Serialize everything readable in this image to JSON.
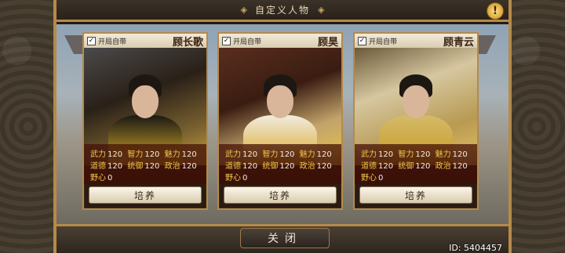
{
  "header": {
    "title": "自定义人物",
    "ornament_left": "◈",
    "ornament_right": "◈",
    "warn_icon": "!"
  },
  "cards": [
    {
      "option_label": "开局自带",
      "checked": true,
      "name": "顾长歌",
      "stats": {
        "wuli": {
          "k": "武力",
          "v": "120"
        },
        "zhili": {
          "k": "智力",
          "v": "120"
        },
        "meili": {
          "k": "魅力",
          "v": "120"
        },
        "daode": {
          "k": "道德",
          "v": "120"
        },
        "tongyu": {
          "k": "统御",
          "v": "120"
        },
        "zhengzhi": {
          "k": "政治",
          "v": "120"
        },
        "yexin": {
          "k": "野心",
          "v": "0"
        }
      },
      "train_label": "培养"
    },
    {
      "option_label": "开局自带",
      "checked": true,
      "name": "顾昊",
      "stats": {
        "wuli": {
          "k": "武力",
          "v": "120"
        },
        "zhili": {
          "k": "智力",
          "v": "120"
        },
        "meili": {
          "k": "魅力",
          "v": "120"
        },
        "daode": {
          "k": "道德",
          "v": "120"
        },
        "tongyu": {
          "k": "统御",
          "v": "120"
        },
        "zhengzhi": {
          "k": "政治",
          "v": "120"
        },
        "yexin": {
          "k": "野心",
          "v": "0"
        }
      },
      "train_label": "培养"
    },
    {
      "option_label": "开局自带",
      "checked": true,
      "name": "顾青云",
      "stats": {
        "wuli": {
          "k": "武力",
          "v": "120"
        },
        "zhili": {
          "k": "智力",
          "v": "120"
        },
        "meili": {
          "k": "魅力",
          "v": "120"
        },
        "daode": {
          "k": "道德",
          "v": "120"
        },
        "tongyu": {
          "k": "统御",
          "v": "120"
        },
        "zhengzhi": {
          "k": "政治",
          "v": "120"
        },
        "yexin": {
          "k": "野心",
          "v": "0"
        }
      },
      "train_label": "培养"
    }
  ],
  "footer": {
    "close_label": "关闭",
    "id_text": "ID: 5404457"
  },
  "icons": {
    "check": "✓"
  }
}
